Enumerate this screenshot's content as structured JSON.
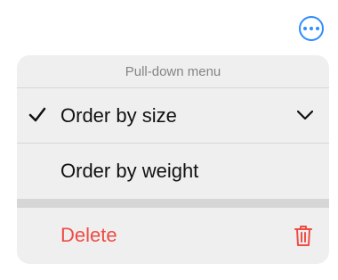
{
  "menu": {
    "title": "Pull-down menu",
    "items": [
      {
        "label": "Order by size"
      },
      {
        "label": "Order by weight"
      }
    ],
    "delete": {
      "label": "Delete"
    }
  },
  "icons": {
    "more": "ellipsis-circle-icon",
    "check": "checkmark-icon",
    "chevron": "chevron-down-icon",
    "trash": "trash-icon"
  },
  "colors": {
    "accent": "#2f8cff",
    "destructive": "#f04b44",
    "menu_background": "#efefef",
    "header_text": "#858585"
  }
}
